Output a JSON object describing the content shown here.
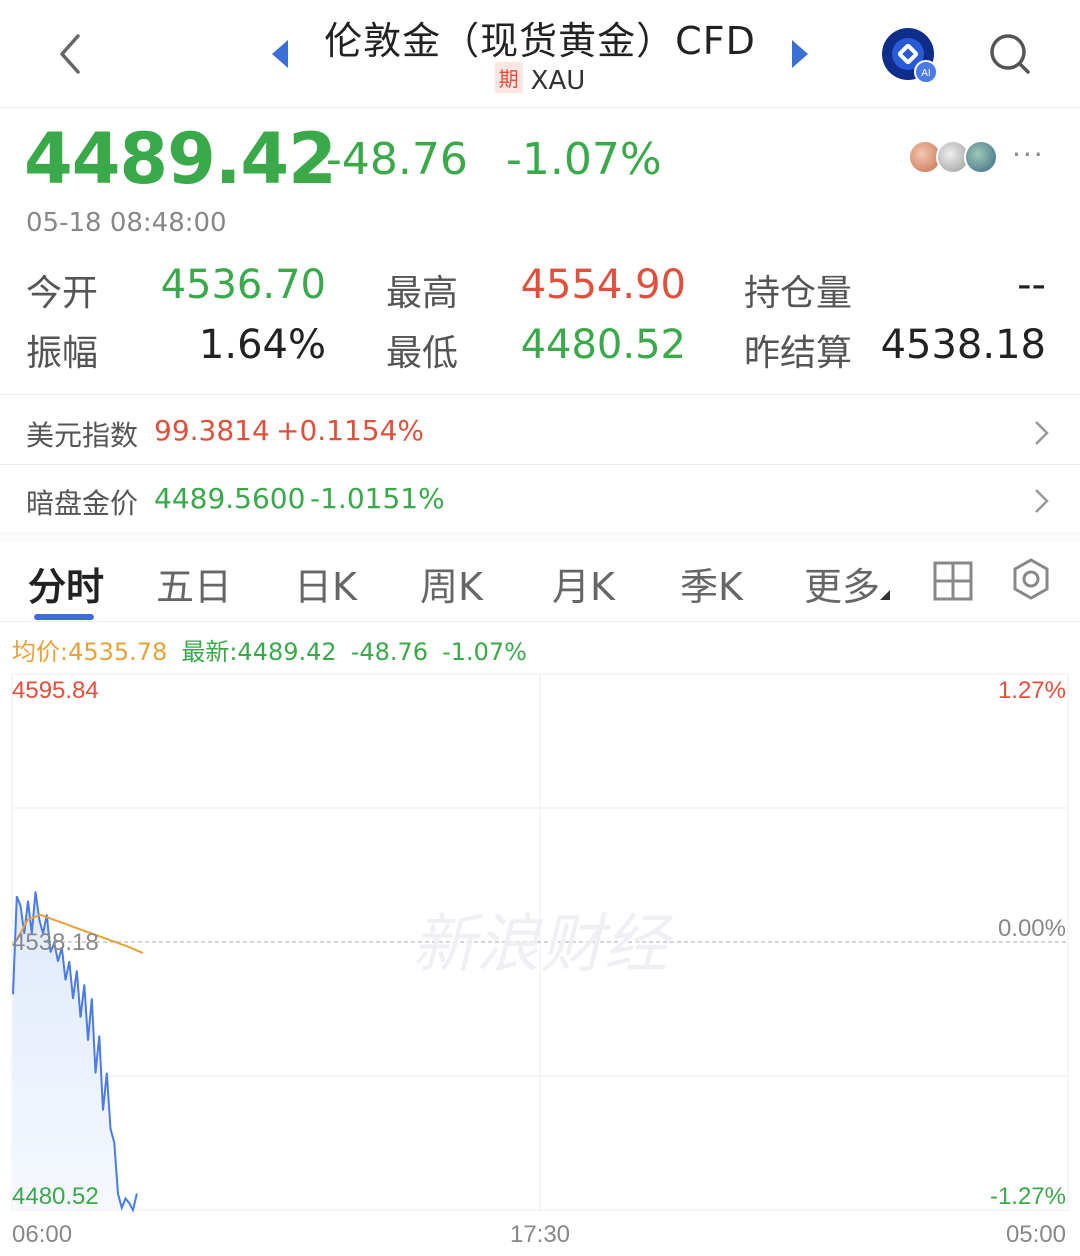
{
  "header": {
    "title": "伦敦金（现货黄金）CFD",
    "badge": "期",
    "symbol": "XAU"
  },
  "quote": {
    "price": "4489.42",
    "change": "-48.76",
    "change_pct": "-1.07%",
    "timestamp": "05-18 08:48:00"
  },
  "stats": {
    "open_label": "今开",
    "open_value": "4536.70",
    "high_label": "最高",
    "high_value": "4554.90",
    "oi_label": "持仓量",
    "oi_value": "--",
    "amp_label": "振幅",
    "amp_value": "1.64%",
    "low_label": "最低",
    "low_value": "4480.52",
    "settle_label": "昨结算",
    "settle_value": "4538.18"
  },
  "related": [
    {
      "label": "美元指数",
      "value": "99.3814",
      "change": "+0.1154%"
    },
    {
      "label": "暗盘金价",
      "value": "4489.5600",
      "change": "-1.0151%"
    }
  ],
  "tabs": [
    "分时",
    "五日",
    "日K",
    "周K",
    "月K",
    "季K",
    "更多"
  ],
  "legend": {
    "avg": "均价:4535.78",
    "latest": "最新:4489.42",
    "change": "-48.76",
    "pct": "-1.07%"
  },
  "watermark": "新浪财经",
  "colors": {
    "up": "#e0503c",
    "down": "#3aa94a",
    "accent": "#3b6fd8",
    "avg_line": "#e8a23a"
  },
  "chart_data": {
    "type": "line",
    "y_axis_left": {
      "top": "4595.84",
      "mid": "4538.18",
      "bottom": "4480.52"
    },
    "y_axis_right": {
      "top": "1.27%",
      "mid": "0.00%",
      "bottom": "-1.27%"
    },
    "x_ticks": [
      "06:00",
      "17:30",
      "05:00"
    ],
    "ylim": [
      4480.52,
      4595.84
    ],
    "reference": 4538.18,
    "series": [
      {
        "name": "最新",
        "values": [
          4527,
          4548,
          4546,
          4540,
          4547,
          4540,
          4549,
          4543,
          4540,
          4544,
          4536,
          4538,
          4534,
          4537,
          4530,
          4534,
          4526,
          4532,
          4522,
          4529,
          4517,
          4526,
          4510,
          4518,
          4502,
          4510,
          4498,
          4495,
          4484,
          4481,
          4483,
          4482,
          4480.5,
          4484
        ]
      },
      {
        "name": "均价",
        "values": [
          4538,
          4543,
          4544,
          4543,
          4542,
          4541,
          4540,
          4539,
          4538,
          4537,
          4535.8
        ]
      }
    ]
  }
}
